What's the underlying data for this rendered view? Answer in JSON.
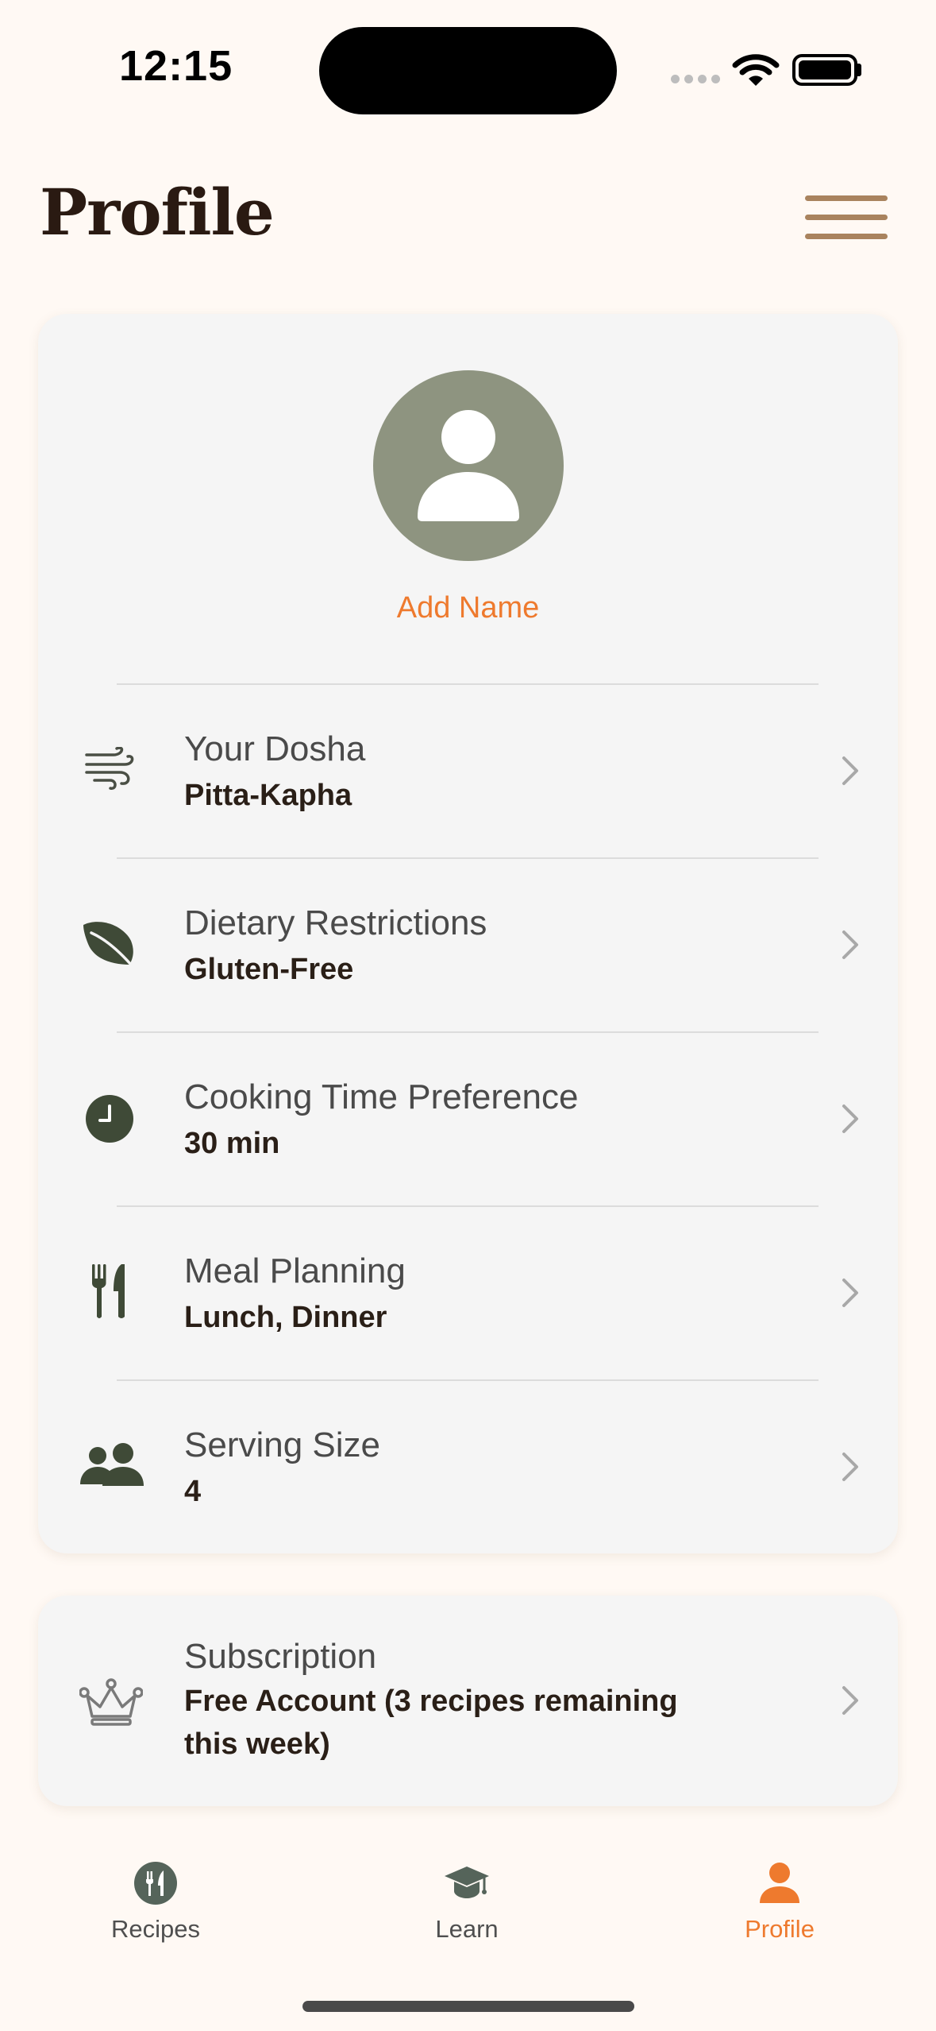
{
  "status_bar": {
    "time": "12:15"
  },
  "header": {
    "title": "Profile",
    "menu_icon": "hamburger-icon"
  },
  "profile": {
    "add_name_label": "Add Name",
    "avatar_icon": "person-icon"
  },
  "settings": [
    {
      "icon": "wind-icon",
      "label": "Your Dosha",
      "value": "Pitta-Kapha"
    },
    {
      "icon": "leaf-icon",
      "label": "Dietary Restrictions",
      "value": "Gluten-Free"
    },
    {
      "icon": "clock-icon",
      "label": "Cooking Time Preference",
      "value": "30 min"
    },
    {
      "icon": "fork-knife-icon",
      "label": "Meal Planning",
      "value": "Lunch, Dinner"
    },
    {
      "icon": "people-icon",
      "label": "Serving Size",
      "value": "4"
    }
  ],
  "subscription": {
    "icon": "crown-icon",
    "label": "Subscription",
    "value_line1": "Free Account (3 recipes remaining",
    "value_line2": "this week)"
  },
  "tabs": [
    {
      "label": "Recipes",
      "icon": "recipes-icon",
      "active": false
    },
    {
      "label": "Learn",
      "icon": "graduation-cap-icon",
      "active": false
    },
    {
      "label": "Profile",
      "icon": "profile-icon",
      "active": true
    }
  ],
  "colors": {
    "background": "#FFF9F4",
    "accent": "#EE7A2E",
    "icon_dark_green": "#3F4A37",
    "avatar_bg": "#8E9480",
    "menu_brown": "#A9835E"
  }
}
